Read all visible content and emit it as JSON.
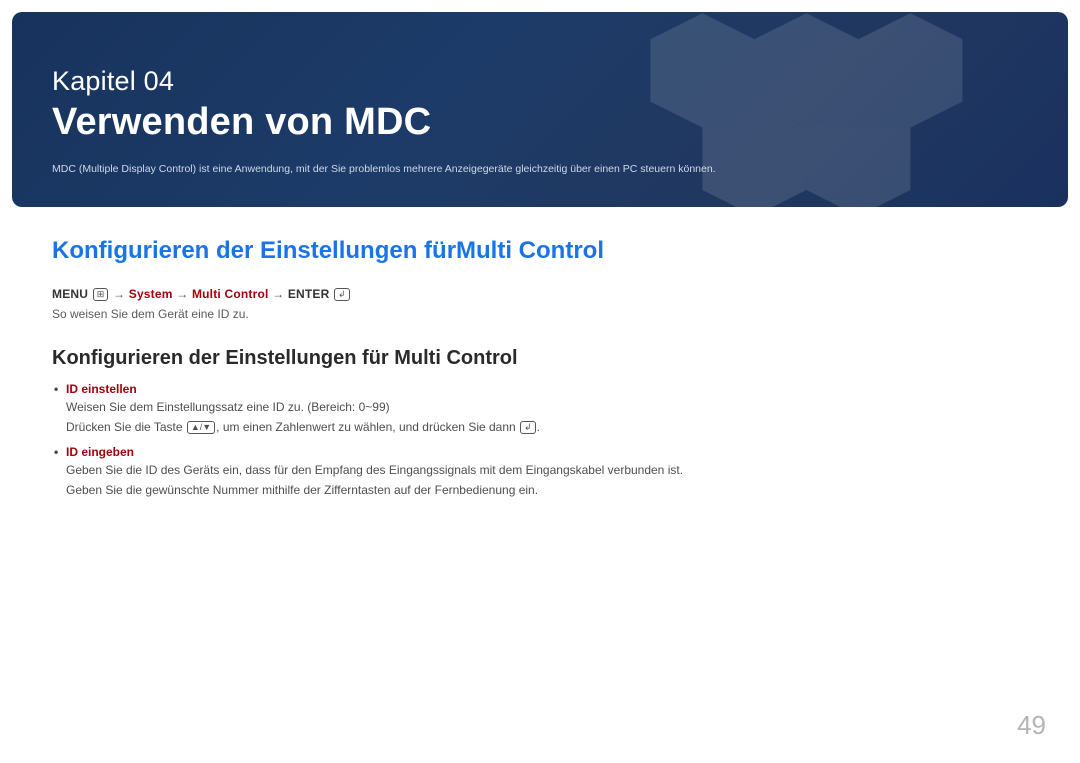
{
  "chapter": {
    "label": "Kapitel 04",
    "title": "Verwenden von MDC",
    "description": "MDC (Multiple Display Control) ist eine Anwendung, mit der Sie problemlos mehrere Anzeigegeräte gleichzeitig über einen PC steuern können."
  },
  "section": {
    "heading": "Konfigurieren der Einstellungen fürMulti Control",
    "nav": {
      "menu_label": "MENU",
      "menu_icon_glyph": "⊞",
      "arrow": "→",
      "system_label": "System",
      "multi_control_label": "Multi Control",
      "enter_label": "ENTER",
      "enter_icon_glyph": "↲"
    },
    "intro": "So weisen Sie dem Gerät eine ID zu.",
    "subheading": "Konfigurieren der Einstellungen für Multi Control",
    "items": [
      {
        "label": "ID einstellen",
        "lines": [
          "Weisen Sie dem Einstellungssatz eine ID zu. (Bereich: 0~99)"
        ],
        "key_line_prefix": "Drücken Sie die Taste ",
        "key_line_middle": ", um einen Zahlenwert zu wählen, und drücken Sie dann ",
        "key_line_suffix": "."
      },
      {
        "label": "ID eingeben",
        "lines": [
          "Geben Sie die ID des Geräts ein, dass für den Empfang des Eingangssignals mit dem Eingangskabel verbunden ist.",
          "Geben Sie die gewünschte Nummer mithilfe der Zifferntasten auf der Fernbedienung ein."
        ]
      }
    ]
  },
  "page_number": "49",
  "glyphs": {
    "up_down": "▲/▼",
    "enter": "↲"
  }
}
